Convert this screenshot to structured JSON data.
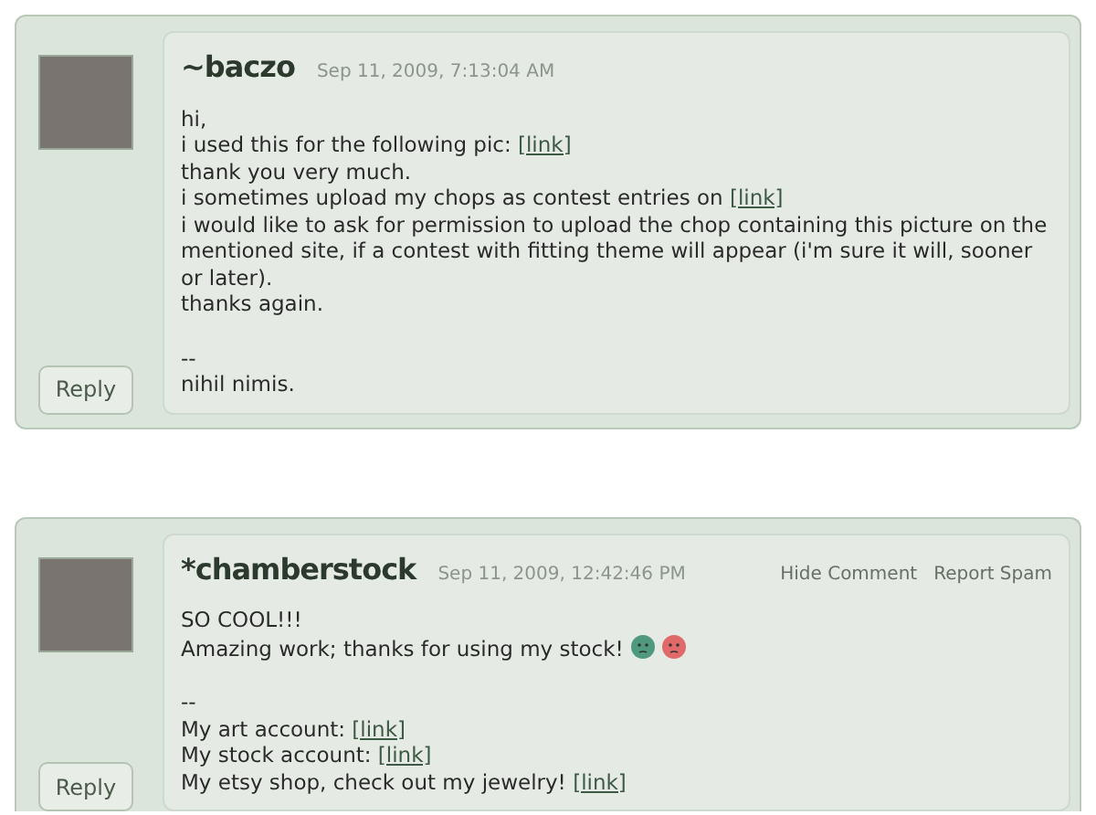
{
  "comments": [
    {
      "author": "~baczo",
      "time": "Sep 11, 2009, 7:13:04 AM",
      "reply": "Reply",
      "lines": [
        {
          "kind": "text",
          "segments": [
            {
              "kind": "text",
              "text": "hi,"
            }
          ]
        },
        {
          "kind": "text",
          "segments": [
            {
              "kind": "text",
              "text": "i used this for the following pic: "
            },
            {
              "kind": "link",
              "text": "[link]"
            }
          ]
        },
        {
          "kind": "text",
          "segments": [
            {
              "kind": "text",
              "text": "thank you very much."
            }
          ]
        },
        {
          "kind": "text",
          "segments": [
            {
              "kind": "text",
              "text": "i sometimes upload my chops as contest entries on "
            },
            {
              "kind": "link",
              "text": "[link]"
            }
          ]
        },
        {
          "kind": "text",
          "segments": [
            {
              "kind": "text",
              "text": "i would like to ask for permission to upload the chop containing this picture on the mentioned site, if a contest with fitting theme will appear (i'm sure it will, sooner or later)."
            }
          ]
        },
        {
          "kind": "text",
          "segments": [
            {
              "kind": "text",
              "text": "thanks again."
            }
          ]
        },
        {
          "kind": "blank"
        },
        {
          "kind": "text",
          "segments": [
            {
              "kind": "text",
              "text": "--"
            }
          ]
        },
        {
          "kind": "text",
          "segments": [
            {
              "kind": "text",
              "text": "nihil nimis."
            }
          ]
        }
      ]
    },
    {
      "author": "*chamberstock",
      "time": "Sep 11, 2009, 12:42:46 PM",
      "actions": [
        "Hide Comment",
        "Report Spam"
      ],
      "reply": "Reply",
      "lines": [
        {
          "kind": "text",
          "segments": [
            {
              "kind": "text",
              "text": "SO COOL!!!"
            }
          ]
        },
        {
          "kind": "text",
          "segments": [
            {
              "kind": "text",
              "text": "Amazing work; thanks for using my stock! "
            },
            {
              "kind": "emoticon",
              "color": "#4f9a7f"
            },
            {
              "kind": "emoticon",
              "color": "#e06a6a"
            }
          ]
        },
        {
          "kind": "blank"
        },
        {
          "kind": "text",
          "segments": [
            {
              "kind": "text",
              "text": "--"
            }
          ]
        },
        {
          "kind": "text",
          "segments": [
            {
              "kind": "text",
              "text": "My art account: "
            },
            {
              "kind": "link",
              "text": "[link]"
            }
          ]
        },
        {
          "kind": "text",
          "segments": [
            {
              "kind": "text",
              "text": "My stock account: "
            },
            {
              "kind": "link",
              "text": "[link]"
            }
          ]
        },
        {
          "kind": "text",
          "segments": [
            {
              "kind": "text",
              "text": "My etsy shop, check out my jewelry! "
            },
            {
              "kind": "link",
              "text": "[link]"
            }
          ]
        }
      ]
    }
  ]
}
